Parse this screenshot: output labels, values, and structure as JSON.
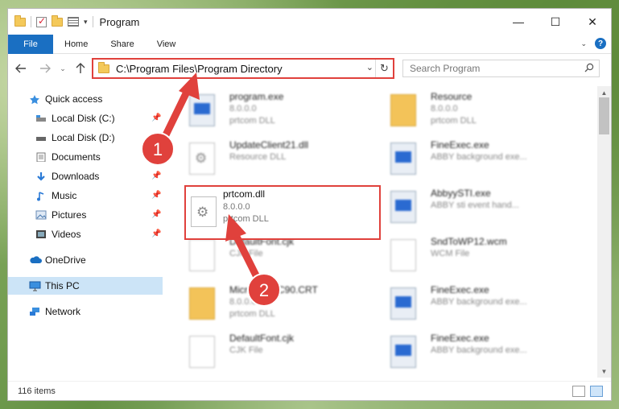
{
  "window": {
    "title": "Program",
    "controls": {
      "minimize": "—",
      "maximize": "☐",
      "close": "✕"
    }
  },
  "ribbon": {
    "tabs": [
      "File",
      "Home",
      "Share",
      "View"
    ],
    "help": "?"
  },
  "nav": {
    "address": "C:\\Program Files\\Program Directory",
    "search_placeholder": "Search Program"
  },
  "sidebar": {
    "items": [
      {
        "label": "Quick access",
        "icon": "star-icon"
      },
      {
        "label": "Local Disk (C:)",
        "icon": "drive-icon"
      },
      {
        "label": "Local Disk (D:)",
        "icon": "drive-icon"
      },
      {
        "label": "Documents",
        "icon": "documents-icon"
      },
      {
        "label": "Downloads",
        "icon": "download-icon"
      },
      {
        "label": "Music",
        "icon": "music-icon"
      },
      {
        "label": "Pictures",
        "icon": "pictures-icon"
      },
      {
        "label": "Videos",
        "icon": "videos-icon"
      },
      {
        "label": "OneDrive",
        "icon": "cloud-icon"
      },
      {
        "label": "This PC",
        "icon": "computer-icon"
      },
      {
        "label": "Network",
        "icon": "network-icon"
      }
    ],
    "selected": "This PC"
  },
  "files": [
    {
      "name": "program.exe",
      "line1": "8.0.0.0",
      "line2": "prtcom DLL",
      "icon": "exe"
    },
    {
      "name": "Resource",
      "line1": "8.0.0.0",
      "line2": "prtcom DLL",
      "icon": "folder"
    },
    {
      "name": "UpdateClient21.dll",
      "line1": "Resource DLL",
      "line2": "",
      "icon": "gear"
    },
    {
      "name": "FineExec.exe",
      "line1": "ABBY background exe...",
      "line2": "",
      "icon": "exe"
    },
    {
      "name": "prtcom.dll",
      "line1": "8.0.0.0",
      "line2": "prtcom DLL",
      "icon": "gear"
    },
    {
      "name": "AbbyySTI.exe",
      "line1": "ABBY sti event hand...",
      "line2": "",
      "icon": "exe"
    },
    {
      "name": "DefaultFont.cjk",
      "line1": "CJK File",
      "line2": "",
      "icon": "doc"
    },
    {
      "name": "SndToWP12.wcm",
      "line1": "WCM File",
      "line2": "",
      "icon": "doc"
    },
    {
      "name": "Microsoft.VC90.CRT",
      "line1": "8.0.0.0",
      "line2": "prtcom DLL",
      "icon": "folder"
    },
    {
      "name": "FineExec.exe",
      "line1": "ABBY background exe...",
      "line2": "",
      "icon": "exe"
    },
    {
      "name": "DefaultFont.cjk",
      "line1": "CJK File",
      "line2": "",
      "icon": "doc"
    },
    {
      "name": "FineExec.exe",
      "line1": "ABBY background exe...",
      "line2": "",
      "icon": "exe"
    }
  ],
  "highlighted_file": {
    "name": "prtcom.dll",
    "line1": "8.0.0.0",
    "line2": "prtcom DLL"
  },
  "status": {
    "items_count": "116 items"
  },
  "annotations": {
    "badge1": "1",
    "badge2": "2",
    "color": "#e0413c"
  }
}
